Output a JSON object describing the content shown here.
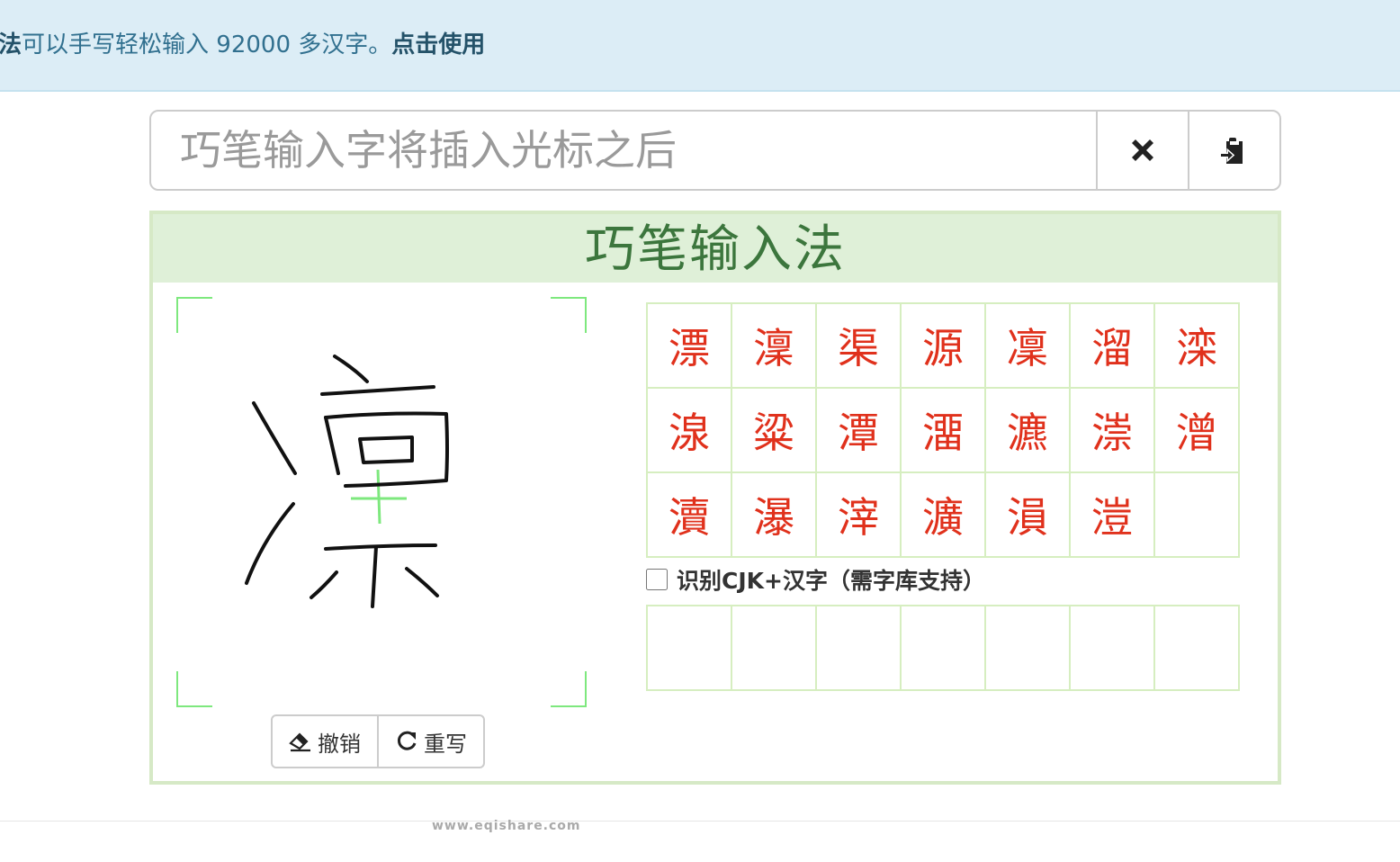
{
  "banner": {
    "lead": "法",
    "text": "可以手写轻松输入 92000 多汉字。",
    "link": "点击使用"
  },
  "search": {
    "placeholder": "巧笔输入字将插入光标之后",
    "value": ""
  },
  "icons": {
    "clear": "close-icon",
    "paste": "clipboard-paste-icon",
    "undo": "eraser-icon",
    "rewrite": "refresh-icon"
  },
  "panel": {
    "title": "巧笔输入法"
  },
  "buttons": {
    "undo": "撤销",
    "rewrite": "重写"
  },
  "candidates": [
    "漂",
    "澟",
    "渠",
    "源",
    "凜",
    "溜",
    "滦",
    "湶",
    "粱",
    "潭",
    "澑",
    "瀌",
    "漴",
    "潧",
    "瀆",
    "瀑",
    "滓",
    "瀇",
    "溳",
    "溰",
    ""
  ],
  "cjk_option": {
    "label": "识别CJK+汉字（需字库支持）",
    "checked": false
  },
  "extra_candidates": [
    "",
    "",
    "",
    "",
    "",
    "",
    ""
  ],
  "colors": {
    "candidate": "#e0311c",
    "panel_border": "#d6e9c6",
    "panel_heading_text": "#3c763d",
    "banner_bg": "#dcedf6"
  },
  "footer": {
    "watermark": "www.eqishare.com"
  }
}
